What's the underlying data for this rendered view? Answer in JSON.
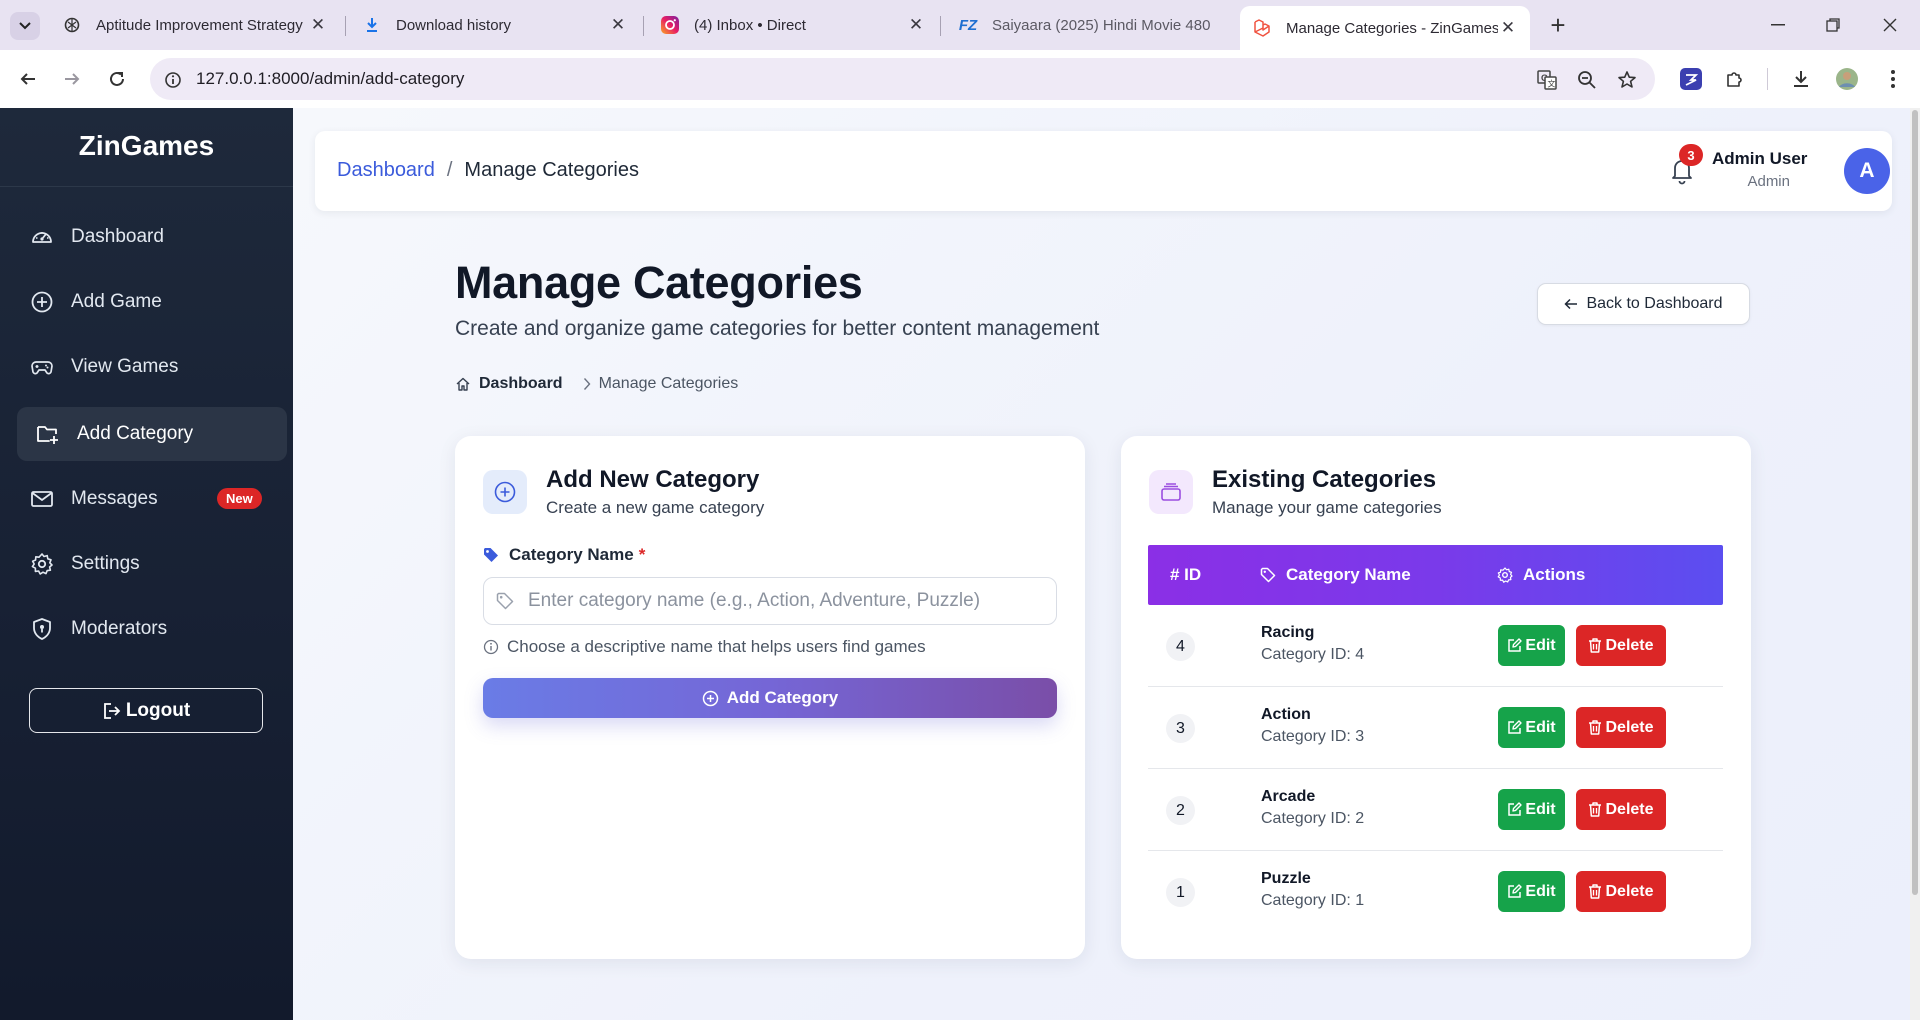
{
  "browser": {
    "tabs": [
      {
        "label": "Aptitude Improvement Strategy",
        "icon": "chatgpt-icon"
      },
      {
        "label": "Download history",
        "icon": "download-icon"
      },
      {
        "label": "(4) Inbox • Direct",
        "icon": "instagram-icon"
      },
      {
        "label": "Saiyaara (2025) Hindi Movie 480",
        "icon": "fz-icon",
        "icon_text": "FZ"
      },
      {
        "label": "Manage Categories - ZinGames",
        "icon": "laravel-icon",
        "active": true
      }
    ],
    "url": "127.0.0.1:8000/admin/add-category"
  },
  "sidebar": {
    "brand": "ZinGames",
    "items": [
      {
        "label": "Dashboard",
        "icon": "dashboard-gauge-icon"
      },
      {
        "label": "Add Game",
        "icon": "plus-circle-icon"
      },
      {
        "label": "View Games",
        "icon": "gamepad-icon"
      },
      {
        "label": "Add Category",
        "icon": "folder-plus-icon",
        "active": true
      },
      {
        "label": "Messages",
        "icon": "envelope-icon",
        "badge": "New"
      },
      {
        "label": "Settings",
        "icon": "gear-icon"
      },
      {
        "label": "Moderators",
        "icon": "shield-icon"
      }
    ],
    "logout_label": "Logout"
  },
  "topbar": {
    "breadcrumb_link": "Dashboard",
    "breadcrumb_sep": "/",
    "breadcrumb_current": "Manage Categories",
    "notification_count": "3",
    "user_name": "Admin User",
    "user_role": "Admin",
    "avatar_letter": "A"
  },
  "header": {
    "title": "Manage Categories",
    "subtitle": "Create and organize game categories for better content management",
    "back_label": "Back to Dashboard",
    "crumb_link": "Dashboard",
    "crumb_current": "Manage Categories"
  },
  "add_card": {
    "title": "Add New Category",
    "subtitle": "Create a new game category",
    "field_label": "Category Name",
    "required_mark": "*",
    "placeholder": "Enter category name (e.g., Action, Adventure, Puzzle)",
    "value": "",
    "hint": "Choose a descriptive name that helps users find games",
    "submit_label": "Add Category"
  },
  "list_card": {
    "title": "Existing Categories",
    "subtitle": "Manage your game categories",
    "columns": {
      "id": "# ID",
      "name": "Category Name",
      "actions": "Actions"
    },
    "rows": [
      {
        "id": "4",
        "name": "Racing",
        "sub": "Category ID: 4"
      },
      {
        "id": "3",
        "name": "Action",
        "sub": "Category ID: 3"
      },
      {
        "id": "2",
        "name": "Arcade",
        "sub": "Category ID: 2"
      },
      {
        "id": "1",
        "name": "Puzzle",
        "sub": "Category ID: 1"
      }
    ],
    "edit_label": "Edit",
    "delete_label": "Delete"
  },
  "colors": {
    "sidebar_bg": "#1e293b",
    "accent_link": "#3b5bdb",
    "edit_green": "#16a34a",
    "delete_red": "#dc2626",
    "table_header_gradient": [
      "#8b2fe6",
      "#5b4ef0"
    ]
  }
}
